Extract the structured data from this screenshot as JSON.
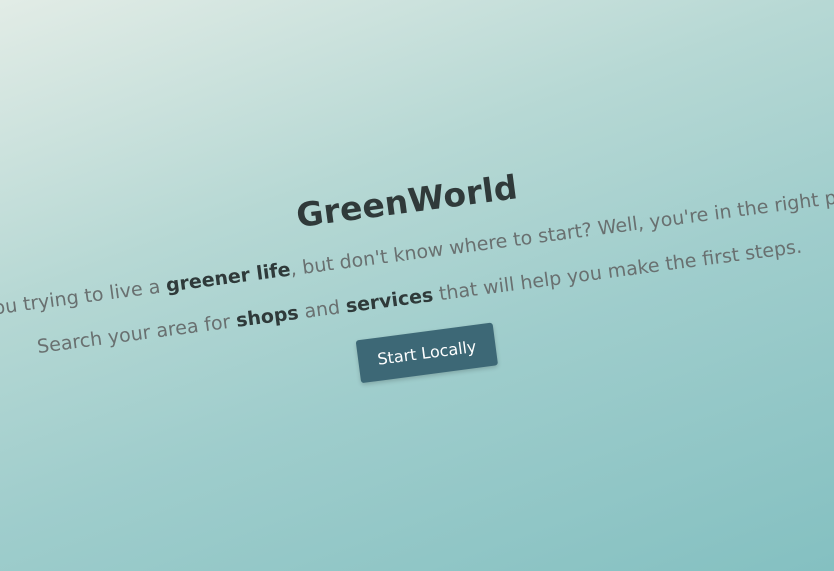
{
  "hero": {
    "title": "GreenWorld",
    "line1": {
      "pre": "Are you trying to live a ",
      "bold": "greener life",
      "post": ", but don't know where to start? Well, you're in the right place!"
    },
    "line2": {
      "pre": "Search your area for ",
      "bold1": "shops",
      "mid": " and ",
      "bold2": "services",
      "post": " that will help you make the first steps."
    },
    "cta_label": "Start Locally"
  },
  "colors": {
    "button": "#3d6876",
    "title": "#303a3a",
    "body_text": "#697070",
    "background_top": "#e2ece6",
    "background_bottom": "#84c0c1"
  }
}
